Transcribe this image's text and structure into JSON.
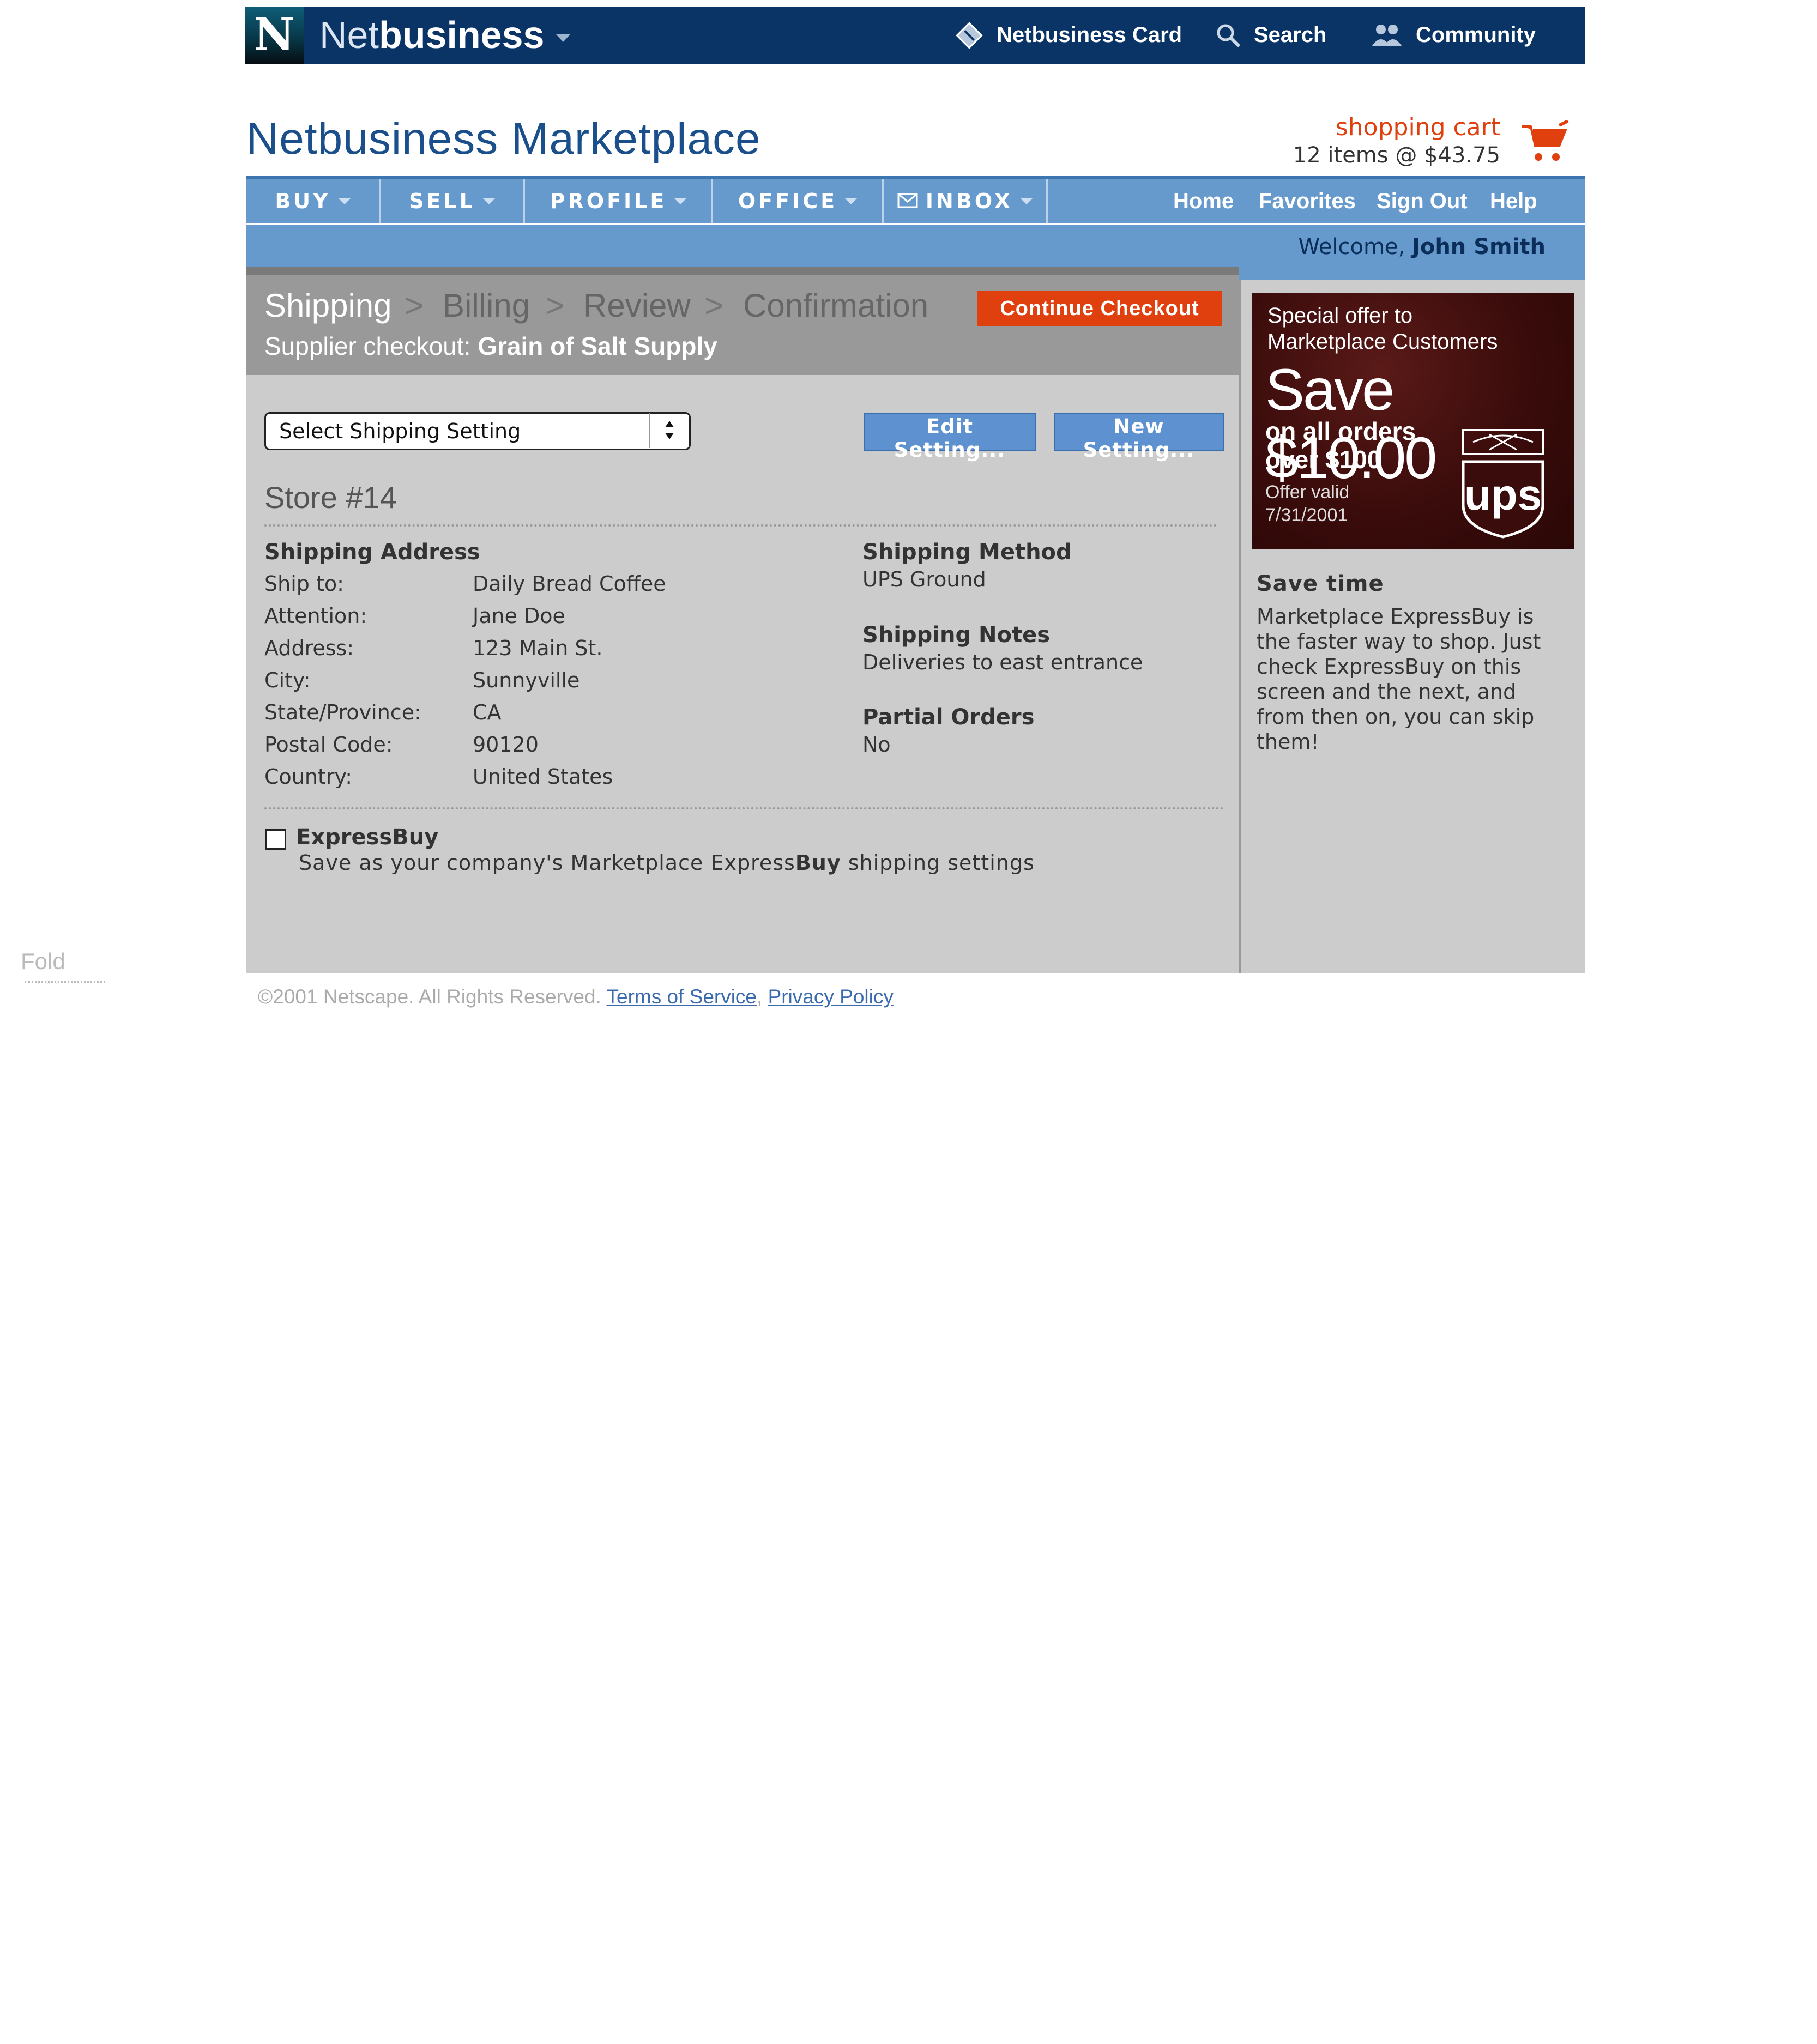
{
  "topbar": {
    "logo_letter": "N",
    "brand_prefix": "Net",
    "brand_suffix": "business",
    "links": {
      "card": "Netbusiness Card",
      "search": "Search",
      "community": "Community"
    },
    "bg_color": "#0b3466",
    "icons": [
      "card-icon",
      "search-icon",
      "community-icon"
    ]
  },
  "header": {
    "title": "Netbusiness Marketplace",
    "cart_label": "shopping cart",
    "cart_info": "12 items @ $43.75",
    "cart_icon": "shopping-cart-icon",
    "accent_color": "#e0400e"
  },
  "nav": {
    "tabs": [
      {
        "label": "BUY"
      },
      {
        "label": "SELL"
      },
      {
        "label": "PROFILE"
      },
      {
        "label": "OFFICE"
      },
      {
        "label": "INBOX"
      }
    ],
    "right_links": [
      "Home",
      "Favorites",
      "Sign Out",
      "Help"
    ],
    "welcome_prefix": "Welcome,",
    "welcome_name": "John Smith",
    "bg_color": "#6699cc"
  },
  "checkout": {
    "steps": [
      "Shipping",
      "Billing",
      "Review",
      "Confirmation"
    ],
    "step_separator": ">",
    "active_step": "Shipping",
    "supplier_label": "Supplier checkout:",
    "supplier_name": "Grain of Salt Supply",
    "continue_label": "Continue Checkout"
  },
  "settings": {
    "select_value": "Select Shipping Setting",
    "edit_label": "Edit Setting...",
    "new_label": "New Setting..."
  },
  "store": {
    "title": "Store #14",
    "address_heading": "Shipping Address",
    "address": [
      {
        "label": "Ship to:",
        "value": "Daily Bread Coffee"
      },
      {
        "label": "Attention:",
        "value": "Jane Doe"
      },
      {
        "label": "Address:",
        "value": "123 Main St."
      },
      {
        "label": "City:",
        "value": "Sunnyville"
      },
      {
        "label": "State/Province:",
        "value": "CA"
      },
      {
        "label": "Postal Code:",
        "value": "90120"
      },
      {
        "label": "Country:",
        "value": "United States"
      }
    ],
    "method_heading": "Shipping Method",
    "method_value": "UPS Ground",
    "notes_heading": "Shipping Notes",
    "notes_value": "Deliveries to east entrance",
    "partial_heading": "Partial Orders",
    "partial_value": "No"
  },
  "express": {
    "label": "ExpressBuy",
    "checked": false,
    "desc_before": "Save as your company's Marketplace Express",
    "desc_bold": "Buy",
    "desc_after": " shipping settings"
  },
  "promo": {
    "line1": "Special offer to",
    "line2": "Marketplace Customers",
    "headline": "Save $10.00",
    "line3": "on all orders",
    "line4": "over $100",
    "offer1": "Offer valid",
    "offer2": "7/31/2001",
    "logo_text": "ups"
  },
  "savetime": {
    "heading": "Save time",
    "text": "Marketplace ExpressBuy is the faster way to shop. Just check ExpressBuy on this screen and the next, and from then on, you can skip them!"
  },
  "footer": {
    "copyright": "©2001 Netscape. All Rights Reserved.",
    "terms": "Terms of Service",
    "comma": ",",
    "privacy": "Privacy Policy"
  },
  "fold_label": "Fold"
}
